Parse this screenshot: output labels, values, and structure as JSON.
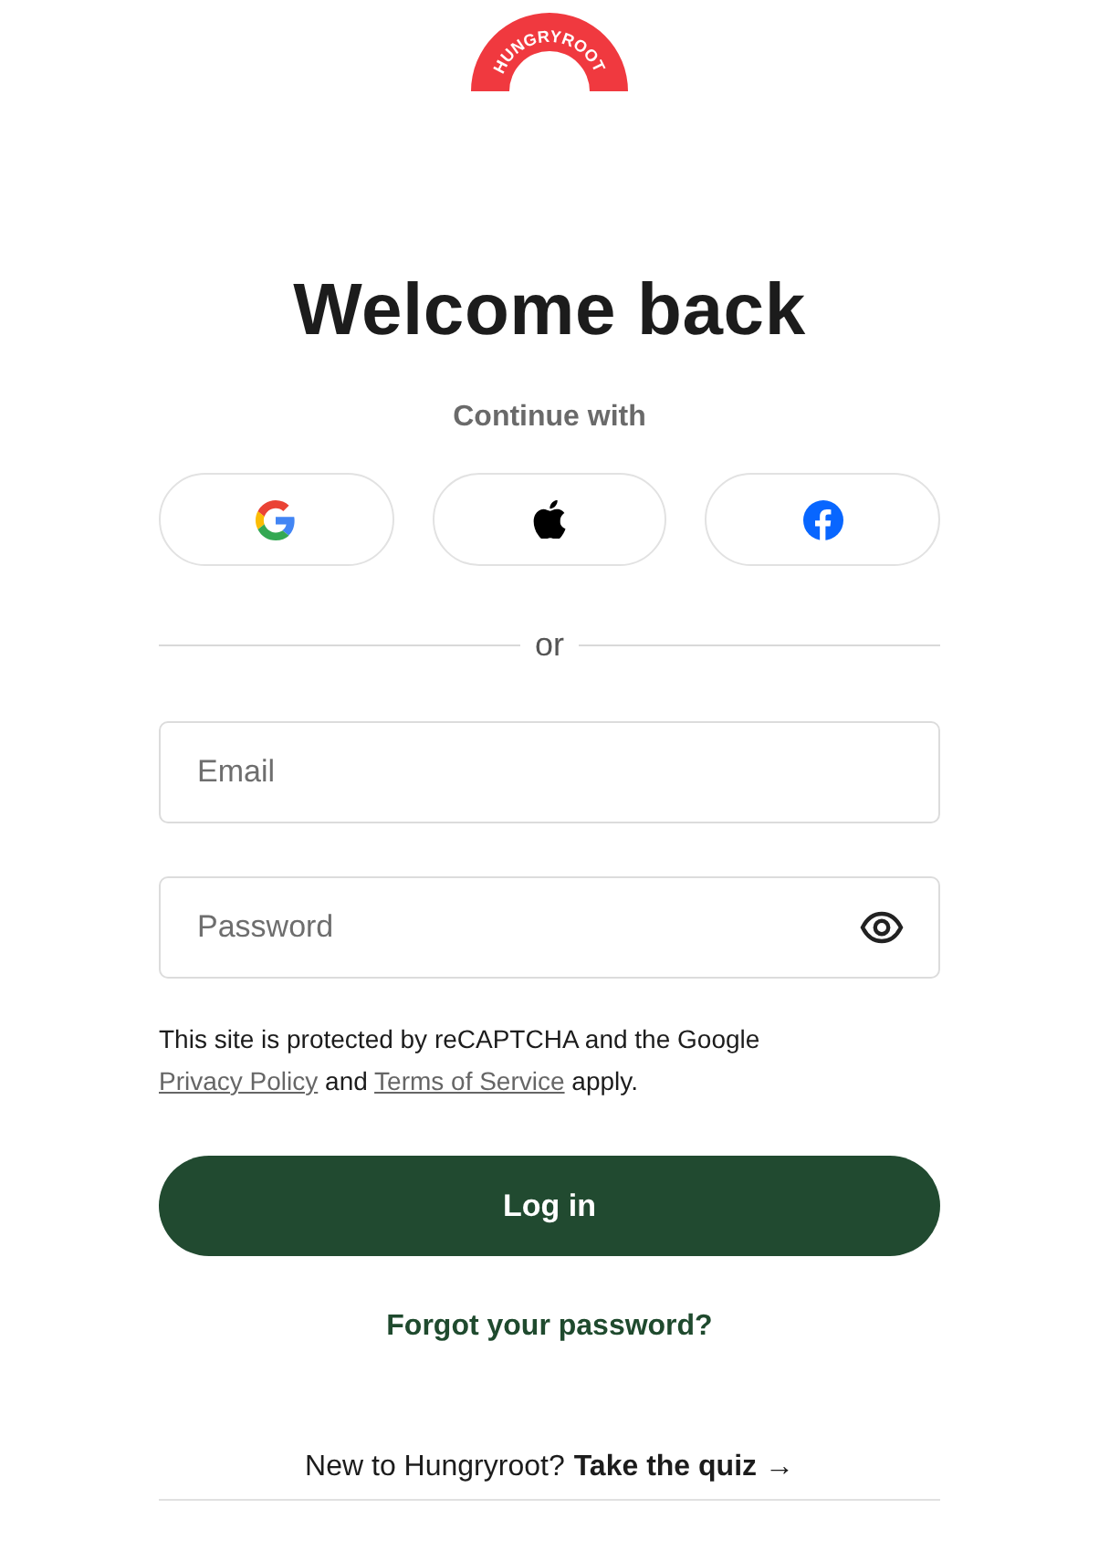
{
  "logo": {
    "text": "HUNGRYROOT"
  },
  "heading": "Welcome back",
  "continue_label": "Continue with",
  "social_buttons": [
    {
      "kind": "google"
    },
    {
      "kind": "apple"
    },
    {
      "kind": "facebook"
    }
  ],
  "divider_label": "or",
  "fields": [
    {
      "placeholder": "Email",
      "kind": "email"
    },
    {
      "placeholder": "Password",
      "kind": "password"
    }
  ],
  "recaptcha": {
    "before": "This site is protected by reCAPTCHA and the Google",
    "privacy_link": "Privacy Policy",
    "middle": "and",
    "terms_link": "Terms of Service",
    "after": "apply."
  },
  "login_button": "Log in",
  "forgot_link": "Forgot your password?",
  "signup": {
    "prompt": "New to Hungryroot?",
    "link": "Take the quiz →"
  }
}
